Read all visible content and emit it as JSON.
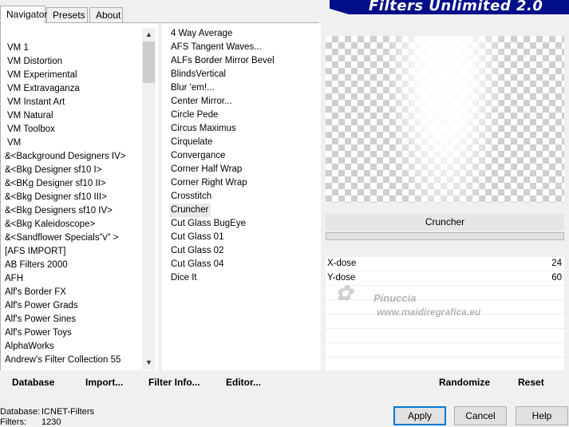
{
  "tabs": [
    {
      "label": "Navigator",
      "active": true
    },
    {
      "label": "Presets",
      "active": false
    },
    {
      "label": "About",
      "active": false
    }
  ],
  "app_title": "Filters Unlimited 2.0",
  "categories": [
    "VM 1",
    "VM Distortion",
    "VM Experimental",
    "VM Extravaganza",
    "VM Instant Art",
    "VM Natural",
    "VM Toolbox",
    "VM",
    "&<Background Designers IV>",
    "&<Bkg Designer sf10 I>",
    "&<BKg Designer sf10 II>",
    "&<Bkg Designer sf10 III>",
    "&<Bkg Designers sf10 IV>",
    "&<Bkg Kaleidoscope>",
    "&<Sandflower Specials\"v\" >",
    "[AFS IMPORT]",
    "AB Filters 2000",
    "AFH",
    "Alf's Border FX",
    "Alf's Power Grads",
    "Alf's Power Sines",
    "Alf's Power Toys",
    "AlphaWorks",
    "Andrew's Filter Collection 55"
  ],
  "filters": [
    "4 Way Average",
    "AFS Tangent Waves...",
    "ALFs Border Mirror Bevel",
    "BlindsVertical",
    "Blur 'em!...",
    "Center Mirror...",
    "Circle Pede",
    "Circus Maximus",
    "Cirquelate",
    "Convergance",
    "Corner Half Wrap",
    "Corner Right Wrap",
    "Crosstitch",
    "Cruncher",
    "Cut Glass  BugEye",
    "Cut Glass 01",
    "Cut Glass 02",
    "Cut Glass 04",
    "Dice It"
  ],
  "selected_filter": "Cruncher",
  "params": [
    {
      "label": "X-dose",
      "value": "24"
    },
    {
      "label": "Y-dose",
      "value": "60"
    }
  ],
  "watermark": {
    "name": "Pinuccia",
    "url": "www.maidiregrafica.eu"
  },
  "bottom_links": {
    "database": "Database",
    "import": "Import...",
    "filter_info": "Filter Info...",
    "editor": "Editor...",
    "randomize": "Randomize",
    "reset": "Reset"
  },
  "status": {
    "database_label": "Database:",
    "database_value": "ICNET-Filters",
    "filters_label": "Filters:",
    "filters_value": "1230"
  },
  "buttons": {
    "apply": "Apply",
    "cancel": "Cancel",
    "help": "Help"
  },
  "colors": {
    "banner": "#000e8a",
    "selected_bg": "#eaeaea"
  }
}
